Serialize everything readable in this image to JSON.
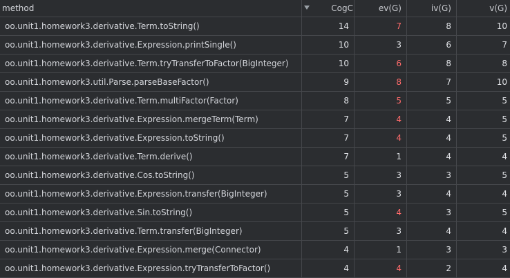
{
  "columns": {
    "method": "method",
    "cogc": "CogC",
    "ev": "ev(G)",
    "iv": "iv(G)",
    "v": "v(G)"
  },
  "sort_icon": "chevron-down-icon",
  "highlight_color": "#ff6b6b",
  "rows": [
    {
      "method": "oo.unit1.homework3.derivative.Term.toString()",
      "cogc": "14",
      "ev": "7",
      "ev_flag": true,
      "iv": "8",
      "v": "10"
    },
    {
      "method": "oo.unit1.homework3.derivative.Expression.printSingle()",
      "cogc": "10",
      "ev": "3",
      "ev_flag": false,
      "iv": "6",
      "v": "7"
    },
    {
      "method": "oo.unit1.homework3.derivative.Term.tryTransferToFactor(BigInteger)",
      "cogc": "10",
      "ev": "6",
      "ev_flag": true,
      "iv": "8",
      "v": "8"
    },
    {
      "method": "oo.unit1.homework3.util.Parse.parseBaseFactor()",
      "cogc": "9",
      "ev": "8",
      "ev_flag": true,
      "iv": "7",
      "v": "10"
    },
    {
      "method": "oo.unit1.homework3.derivative.Term.multiFactor(Factor)",
      "cogc": "8",
      "ev": "5",
      "ev_flag": true,
      "iv": "5",
      "v": "5"
    },
    {
      "method": "oo.unit1.homework3.derivative.Expression.mergeTerm(Term)",
      "cogc": "7",
      "ev": "4",
      "ev_flag": true,
      "iv": "4",
      "v": "5"
    },
    {
      "method": "oo.unit1.homework3.derivative.Expression.toString()",
      "cogc": "7",
      "ev": "4",
      "ev_flag": true,
      "iv": "4",
      "v": "5"
    },
    {
      "method": "oo.unit1.homework3.derivative.Term.derive()",
      "cogc": "7",
      "ev": "1",
      "ev_flag": false,
      "iv": "4",
      "v": "4"
    },
    {
      "method": "oo.unit1.homework3.derivative.Cos.toString()",
      "cogc": "5",
      "ev": "3",
      "ev_flag": false,
      "iv": "3",
      "v": "5"
    },
    {
      "method": "oo.unit1.homework3.derivative.Expression.transfer(BigInteger)",
      "cogc": "5",
      "ev": "3",
      "ev_flag": false,
      "iv": "4",
      "v": "4"
    },
    {
      "method": "oo.unit1.homework3.derivative.Sin.toString()",
      "cogc": "5",
      "ev": "4",
      "ev_flag": true,
      "iv": "3",
      "v": "5"
    },
    {
      "method": "oo.unit1.homework3.derivative.Term.transfer(BigInteger)",
      "cogc": "5",
      "ev": "3",
      "ev_flag": false,
      "iv": "4",
      "v": "4"
    },
    {
      "method": "oo.unit1.homework3.derivative.Expression.merge(Connector)",
      "cogc": "4",
      "ev": "1",
      "ev_flag": false,
      "iv": "3",
      "v": "3"
    },
    {
      "method": "oo.unit1.homework3.derivative.Expression.tryTransferToFactor()",
      "cogc": "4",
      "ev": "4",
      "ev_flag": true,
      "iv": "2",
      "v": "4"
    }
  ]
}
